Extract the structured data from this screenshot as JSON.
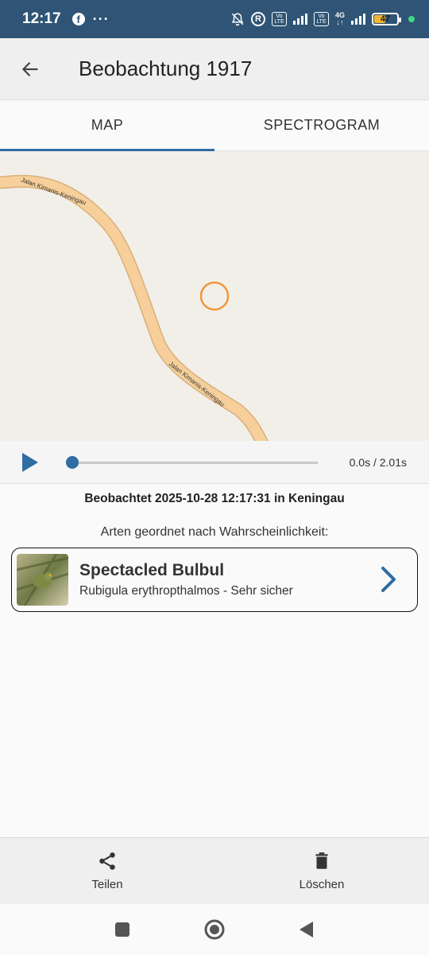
{
  "statusbar": {
    "time": "12:17",
    "battery": "47",
    "network": "4G",
    "volte": "Vo\nLTE"
  },
  "appbar": {
    "title": "Beobachtung 1917"
  },
  "tabs": [
    {
      "label": "MAP",
      "active": true
    },
    {
      "label": "SPECTROGRAM",
      "active": false
    }
  ],
  "map": {
    "road_label_top": "Jalan Kimanis-Keningau",
    "road_label_bottom": "Jalan Kimanis-Keningau",
    "road_color": "#f6cf9a",
    "marker_color": "#f0963c"
  },
  "player": {
    "time": "0.0s / 2.01s",
    "progress": 0
  },
  "observation": {
    "observed": "Beobachtet 2025-10-28 12:17:31 in Keningau",
    "sorted_heading": "Arten geordnet nach Wahrscheinlichkeit:"
  },
  "species": [
    {
      "common_name": "Spectacled Bulbul",
      "scientific": "Rubigula erythropthalmos - Sehr sicher"
    }
  ],
  "actions": {
    "share_label": "Teilen",
    "delete_label": "Löschen"
  },
  "colors": {
    "accent": "#2f6da3",
    "statusbar": "#2f5475"
  }
}
